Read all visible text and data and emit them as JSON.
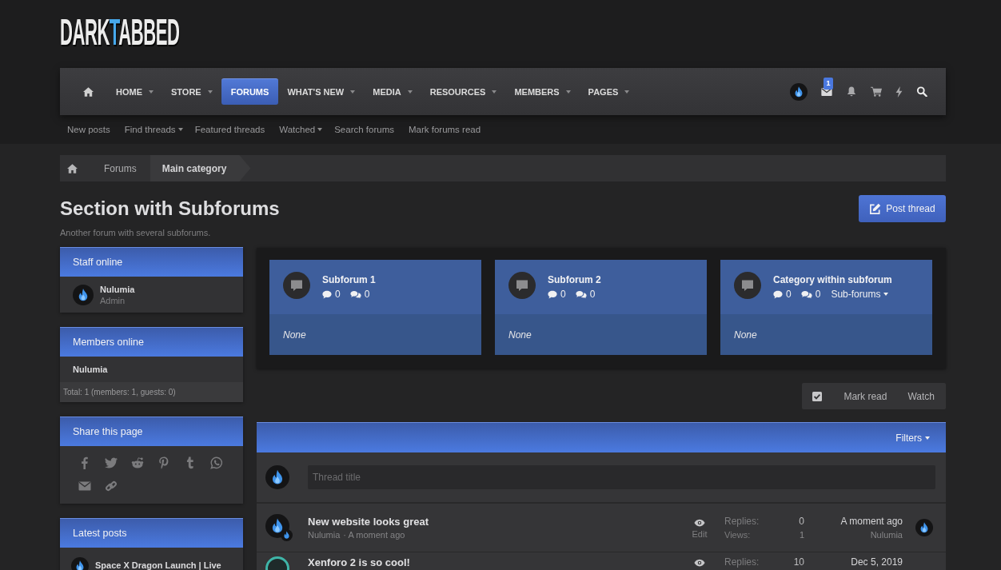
{
  "logo": {
    "text": "DARK**T**ABBED"
  },
  "nav": {
    "tabs": [
      {
        "label": "HOME",
        "selected": false,
        "dropdown": true
      },
      {
        "label": "STORE",
        "selected": false,
        "dropdown": true
      },
      {
        "label": "FORUMS",
        "selected": true,
        "dropdown": false
      },
      {
        "label": "WHAT'S NEW",
        "selected": false,
        "dropdown": true
      },
      {
        "label": "MEDIA",
        "selected": false,
        "dropdown": true
      },
      {
        "label": "RESOURCES",
        "selected": false,
        "dropdown": true
      },
      {
        "label": "MEMBERS",
        "selected": false,
        "dropdown": true
      },
      {
        "label": "PAGES",
        "selected": false,
        "dropdown": true
      }
    ],
    "inbox_badge": "1"
  },
  "subnav": [
    {
      "label": "New posts",
      "dropdown": false
    },
    {
      "label": "Find threads",
      "dropdown": true
    },
    {
      "label": "Featured threads",
      "dropdown": false
    },
    {
      "label": "Watched",
      "dropdown": true
    },
    {
      "label": "Search forums",
      "dropdown": false
    },
    {
      "label": "Mark forums read",
      "dropdown": false
    }
  ],
  "breadcrumb": [
    {
      "label": "Forums",
      "current": false
    },
    {
      "label": "Main category",
      "current": true
    }
  ],
  "page": {
    "title": "Section with Subforums",
    "description": "Another forum with several subforums.",
    "post_button": "Post thread"
  },
  "sidebar": {
    "staff_online": {
      "title": "Staff online",
      "members": [
        {
          "name": "Nulumia",
          "role": "Admin"
        }
      ]
    },
    "members_online": {
      "title": "Members online",
      "members": [
        "Nulumia"
      ],
      "total": "Total: 1 (members: 1, guests: 0)"
    },
    "share": {
      "title": "Share this page"
    },
    "latest_posts": {
      "title": "Latest posts",
      "posts": [
        {
          "title": "Space X Dragon Launch | Live"
        }
      ]
    }
  },
  "subforums": [
    {
      "title": "Subforum 1",
      "threads": "0",
      "messages": "0",
      "last_post": "None"
    },
    {
      "title": "Subforum 2",
      "threads": "0",
      "messages": "0",
      "last_post": "None"
    },
    {
      "title": "Category within subforum",
      "threads": "0",
      "messages": "0",
      "subforums_link": "Sub-forums",
      "last_post": "None"
    }
  ],
  "actions": {
    "mark_read": "Mark read",
    "watch": "Watch"
  },
  "thread_list": {
    "filters": "Filters",
    "quick_thread": {
      "placeholder": "Thread title"
    },
    "threads": [
      {
        "title": "New website looks great",
        "author": "Nulumia",
        "date": "· A moment ago",
        "action": "Edit",
        "replies_label": "Replies:",
        "replies": "0",
        "views_label": "Views:",
        "views": "1",
        "last_date": "A moment ago",
        "last_author": "Nulumia"
      },
      {
        "title": "Xenforo 2 is so cool!",
        "replies_label": "Replies:",
        "replies": "10",
        "last_date": "Dec 5, 2019"
      }
    ]
  }
}
